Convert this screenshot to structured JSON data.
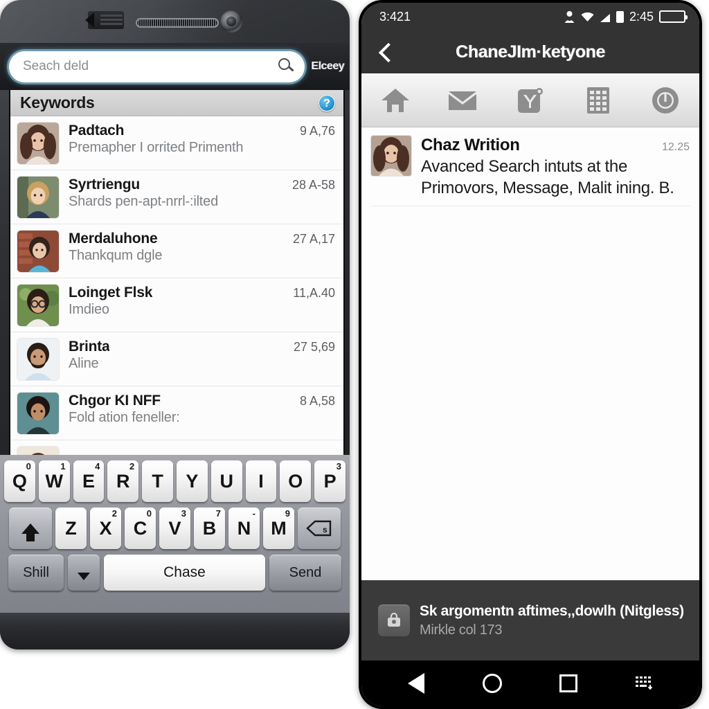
{
  "left_phone": {
    "search": {
      "placeholder": "Seach deld",
      "value": "",
      "search_icon": "search-icon",
      "right_label": "Elceey"
    },
    "section_header": {
      "title": "Keywords",
      "help_icon": "?"
    },
    "list": [
      {
        "name": "Padtach",
        "subtitle": "Premapher I orrited Primenth",
        "meta": "9 A,76"
      },
      {
        "name": "Syrtriengu",
        "subtitle": "Shards pen-apt-nrrl-:ilted",
        "meta": "28 A-58"
      },
      {
        "name": "Merdaluhone",
        "subtitle": "Thankqum dgle",
        "meta": "27 A,17"
      },
      {
        "name": "Loinget Flsk",
        "subtitle": "Imdieo",
        "meta": "11,A.40"
      },
      {
        "name": "Brinta",
        "subtitle": "Aline",
        "meta": "27 5,69"
      },
      {
        "name": "Chgor KI NFF",
        "subtitle": "Fold ation feneller:",
        "meta": "8 A,58"
      }
    ],
    "keyboard": {
      "row1": [
        {
          "key": "Q",
          "sup": "0"
        },
        {
          "key": "W",
          "sup": "1"
        },
        {
          "key": "E",
          "sup": "4"
        },
        {
          "key": "R",
          "sup": "2"
        },
        {
          "key": "T",
          "sup": ""
        },
        {
          "key": "Y",
          "sup": ""
        },
        {
          "key": "U",
          "sup": ""
        },
        {
          "key": "I",
          "sup": ""
        },
        {
          "key": "O",
          "sup": ""
        },
        {
          "key": "P",
          "sup": "3"
        }
      ],
      "row2": [
        {
          "key": "Z",
          "sup": ""
        },
        {
          "key": "X",
          "sup": "2"
        },
        {
          "key": "C",
          "sup": "0"
        },
        {
          "key": "V",
          "sup": "3"
        },
        {
          "key": "B",
          "sup": "7"
        },
        {
          "key": "N",
          "sup": "-"
        },
        {
          "key": "M",
          "sup": "9"
        }
      ],
      "shift_icon": "shift-up-arrow-icon",
      "backspace_icon": "backspace-icon",
      "row3": {
        "left_label": "Shill",
        "dropdown_icon": "caret-down-icon",
        "space_label": "Chase",
        "send_label": "Send"
      }
    }
  },
  "right_phone": {
    "status_bar": {
      "time_left": "3:421",
      "time_right": "2:45",
      "person_icon": "person-alert-icon",
      "wifi_icon": "wifi-icon",
      "signal_icon": "signal-bars-icon",
      "battery_small_icon": "battery-small-icon",
      "battery_icon": "battery-full-icon"
    },
    "app_bar": {
      "back_icon": "back-arrow-icon",
      "title": "ChaneJIm·ketyone"
    },
    "tabs": [
      {
        "icon": "home-icon"
      },
      {
        "icon": "mail-envelope-icon"
      },
      {
        "icon": "yahoo-y-badge-icon"
      },
      {
        "icon": "keypad-grid-icon"
      },
      {
        "icon": "power-circle-icon"
      }
    ],
    "messages": [
      {
        "name": "Chaz Writion",
        "time": "12.25",
        "text": "Avanced Search intuts at the Primovors, Message, Malit ining. B."
      }
    ],
    "footer": {
      "icon": "lock-bag-icon",
      "line1": "Sk argomentn aftimes,,dowlh (Nitgless)",
      "line2": "Mirkle col 173"
    },
    "nav_bar": [
      {
        "icon": "back-triangle-icon"
      },
      {
        "icon": "home-circle-icon"
      },
      {
        "icon": "recents-square-icon"
      },
      {
        "icon": "keyboard-hide-icon"
      }
    ]
  },
  "colors": {
    "accent_blue": "#1c8ecb",
    "dark_chrome": "#333333",
    "key_white": "#ffffff"
  }
}
